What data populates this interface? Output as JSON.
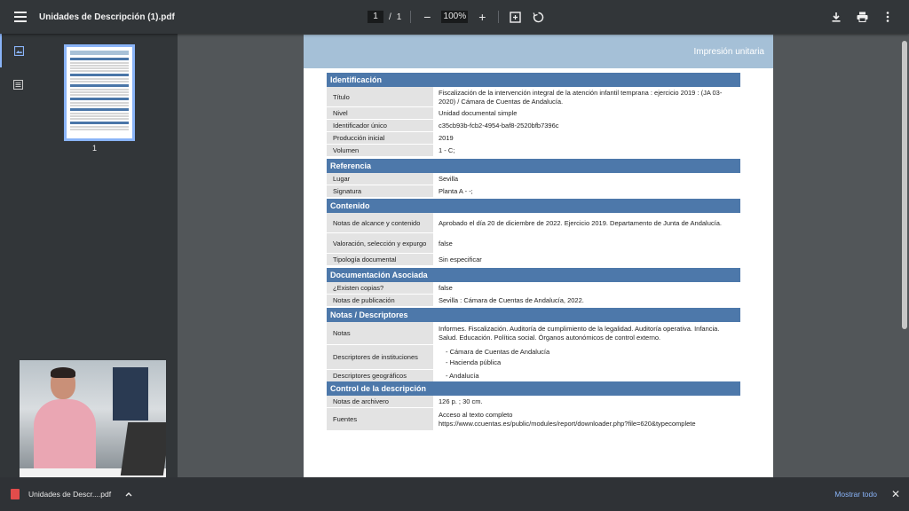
{
  "toolbar": {
    "title": "Unidades de Descripción (1).pdf",
    "page_current": "1",
    "page_sep": "/",
    "page_total": "1",
    "zoom": "100%",
    "zoom_out": "−",
    "zoom_in": "+"
  },
  "sidebar": {
    "thumb_number": "1"
  },
  "document": {
    "header": "Impresión unitaria",
    "sections": [
      {
        "title": "Identificación",
        "rows": [
          {
            "label": "Título",
            "value": "Fiscalización de la intervención integral de la atención infantil temprana : ejercicio 2019 : (JA 03-2020) / Cámara de Cuentas de Andalucía."
          },
          {
            "label": "Nivel",
            "value": "Unidad documental simple"
          },
          {
            "label": "Identificador único",
            "value": "c35cb93b-fcb2-4954-baf8-2520bfb7396c"
          },
          {
            "label": "Producción inicial",
            "value": "2019"
          },
          {
            "label": "Volumen",
            "value": "1 - C;"
          }
        ]
      },
      {
        "title": "Referencia",
        "rows": [
          {
            "label": "Lugar",
            "value": "Sevilla"
          },
          {
            "label": "Signatura",
            "value": "Planta A - -;"
          }
        ]
      },
      {
        "title": "Contenido",
        "rows": [
          {
            "label": "Notas de alcance y contenido",
            "value": "Aprobado el día 20 de diciembre de 2022. Ejercicio 2019. Departamento de Junta de Andalucía."
          },
          {
            "label": "Valoración, selección y expurgo",
            "value": "false"
          },
          {
            "label": "Tipología documental",
            "value": "Sin especificar"
          }
        ]
      },
      {
        "title": "Documentación Asociada",
        "rows": [
          {
            "label": "¿Existen copias?",
            "value": "false"
          },
          {
            "label": "Notas de publicación",
            "value": "Sevilla : Cámara de Cuentas de Andalucía, 2022."
          }
        ]
      },
      {
        "title": "Notas / Descriptores",
        "rows": [
          {
            "label": "Notas",
            "value": "Informes. Fiscalización. Auditoría de cumplimiento de la legalidad. Auditoría operativa. Infancia. Salud. Educación. Política social. Órganos autonómicos de control externo."
          },
          {
            "label": "Descriptores de instituciones",
            "value": "- Cámara de Cuentas de Andalucía",
            "value2": "- Hacienda pública"
          },
          {
            "label": "Descriptores geográficos",
            "value": "- Andalucía"
          }
        ]
      },
      {
        "title": "Control de la descripción",
        "rows": [
          {
            "label": "Notas de archivero",
            "value": "126 p. ; 30 cm."
          },
          {
            "label": "Fuentes",
            "value": "Acceso al texto completo",
            "value2": "https://www.ccuentas.es/public/modules/report/downloader.php?file=620&typecomplete"
          }
        ]
      }
    ]
  },
  "downloads": {
    "file": "Unidades de Descr....pdf",
    "show_all": "Mostrar todo",
    "close": "✕"
  }
}
